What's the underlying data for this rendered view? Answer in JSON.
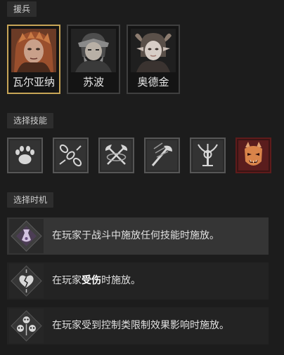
{
  "sections": {
    "mercenary_label": "援兵",
    "skill_label": "选择技能",
    "timing_label": "选择时机"
  },
  "mercenaries": [
    {
      "name": "瓦尔亚纳",
      "selected": true
    },
    {
      "name": "苏波",
      "selected": false
    },
    {
      "name": "奥德金",
      "selected": false
    }
  ],
  "skills": [
    {
      "icon": "bear-paw-icon",
      "selected": false
    },
    {
      "icon": "chain-icon",
      "selected": false
    },
    {
      "icon": "crossed-axes-icon",
      "selected": false
    },
    {
      "icon": "claw-slash-axe-icon",
      "selected": false
    },
    {
      "icon": "tree-sigil-icon",
      "selected": false
    },
    {
      "icon": "demon-face-icon",
      "selected": true
    }
  ],
  "timings": [
    {
      "prefix": "在玩家于战斗中施放任何技能时施放。",
      "highlight": "",
      "suffix": "",
      "icon": "potion-sigil-icon",
      "selected": true
    },
    {
      "prefix": "在玩家",
      "highlight": "受伤",
      "suffix": "时施放。",
      "icon": "broken-heart-icon",
      "selected": false
    },
    {
      "prefix": "在玩家受到控制类限制效果影响时施放。",
      "highlight": "",
      "suffix": "",
      "icon": "skull-trio-icon",
      "selected": false
    }
  ],
  "colors": {
    "selected_border": "#c7a557",
    "selected_skill_border": "#5f1b1b"
  }
}
